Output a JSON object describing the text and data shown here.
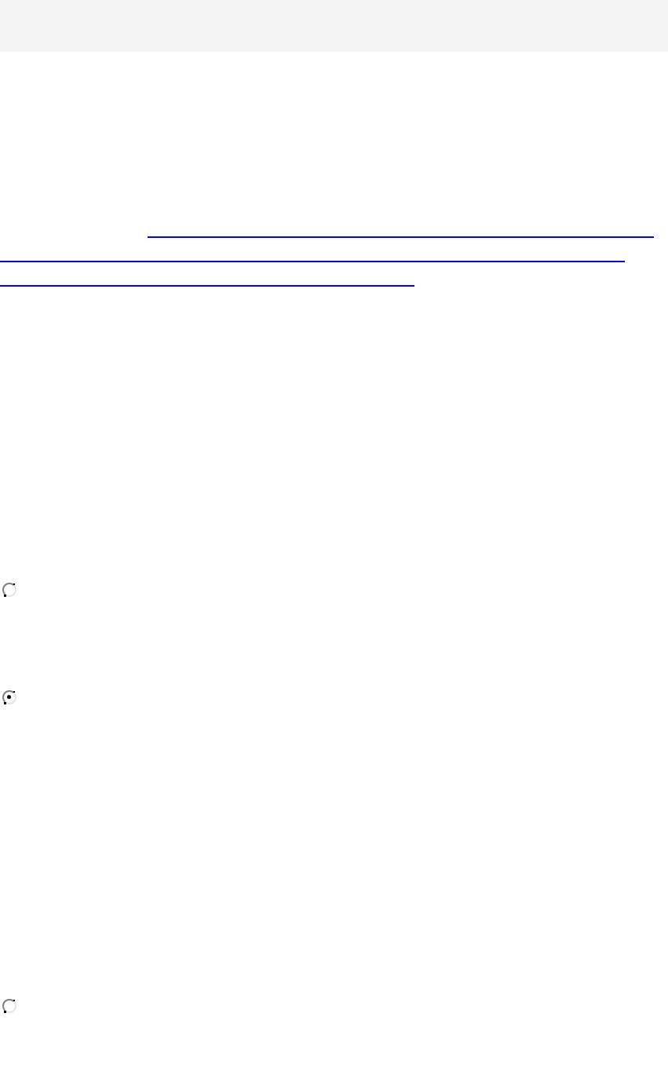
{
  "radio_buttons": [
    {
      "selected": false
    },
    {
      "selected": true
    },
    {
      "selected": false
    }
  ]
}
